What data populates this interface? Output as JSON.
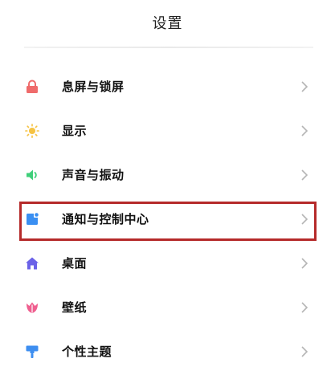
{
  "header": {
    "title": "设置"
  },
  "settings": {
    "items": [
      {
        "label": "息屏与锁屏",
        "icon": "lock-icon",
        "color": "#ef6b6b"
      },
      {
        "label": "显示",
        "icon": "sun-icon",
        "color": "#f6c343"
      },
      {
        "label": "声音与振动",
        "icon": "speaker-icon",
        "color": "#3fcf7a"
      },
      {
        "label": "通知与控制中心",
        "icon": "notification-icon",
        "color": "#3a8ff2"
      },
      {
        "label": "桌面",
        "icon": "home-icon",
        "color": "#6b62e8"
      },
      {
        "label": "壁纸",
        "icon": "tulip-icon",
        "color": "#ef5f8f"
      },
      {
        "label": "个性主题",
        "icon": "paint-roller-icon",
        "color": "#3d8ef0"
      }
    ]
  },
  "highlight": {
    "item_index": 3,
    "color": "#b52a2a"
  }
}
